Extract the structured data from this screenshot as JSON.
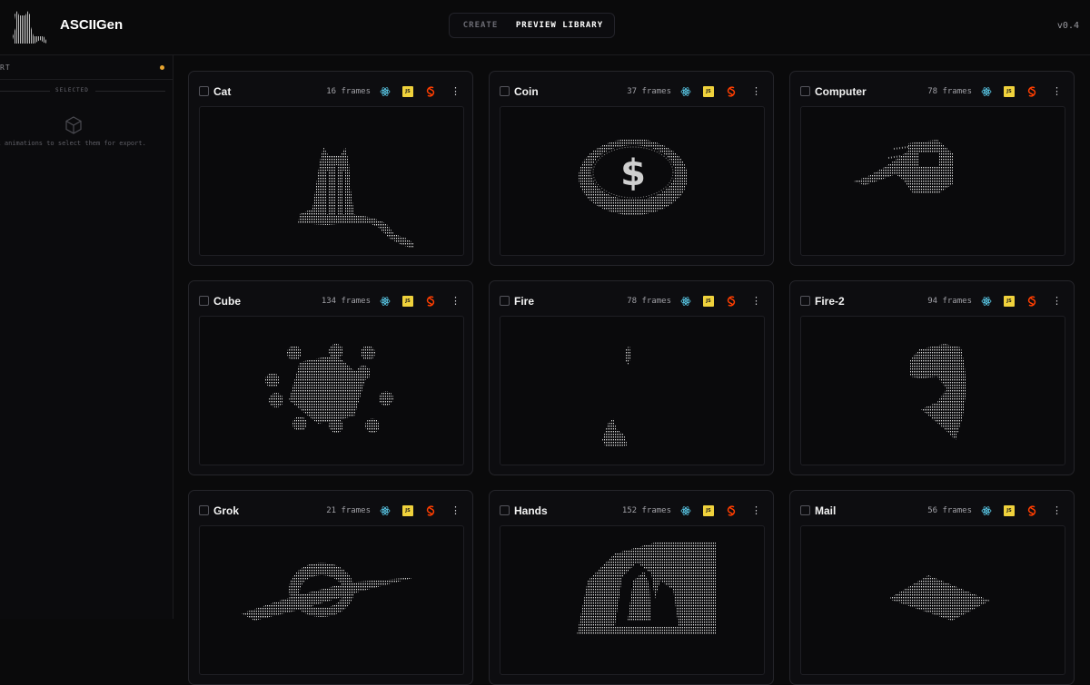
{
  "header": {
    "app_title": "ASCIIGen",
    "tabs": [
      {
        "label": "CREATE",
        "active": false
      },
      {
        "label": "PREVIEW LIBRARY",
        "active": true
      }
    ],
    "version": "v0.4"
  },
  "sidebar": {
    "header_label": "RT",
    "selected_label": "SELECTED",
    "empty_hint": "ick animations to select them for export.",
    "status_dot_color": "#e8a530"
  },
  "library": {
    "cards": [
      {
        "title": "Cat",
        "frames": "16 frames",
        "art": "cat"
      },
      {
        "title": "Coin",
        "frames": "37 frames",
        "art": "coin"
      },
      {
        "title": "Computer",
        "frames": "78 frames",
        "art": "computer"
      },
      {
        "title": "Cube",
        "frames": "134 frames",
        "art": "cube"
      },
      {
        "title": "Fire",
        "frames": "78 frames",
        "art": "fire"
      },
      {
        "title": "Fire-2",
        "frames": "94 frames",
        "art": "fire2"
      },
      {
        "title": "Grok",
        "frames": "21 frames",
        "art": "grok"
      },
      {
        "title": "Hands",
        "frames": "152 frames",
        "art": "hands"
      },
      {
        "title": "Mail",
        "frames": "56 frames",
        "art": "mail"
      }
    ],
    "badges": {
      "js_label": "JS"
    },
    "icons": {
      "react": "react-icon",
      "js": "javascript-icon",
      "svelte": "svelte-icon",
      "more": "more-vertical-icon"
    },
    "colors": {
      "react": "#61dafb",
      "js": "#f0d23c",
      "svelte": "#ff3e00"
    }
  }
}
